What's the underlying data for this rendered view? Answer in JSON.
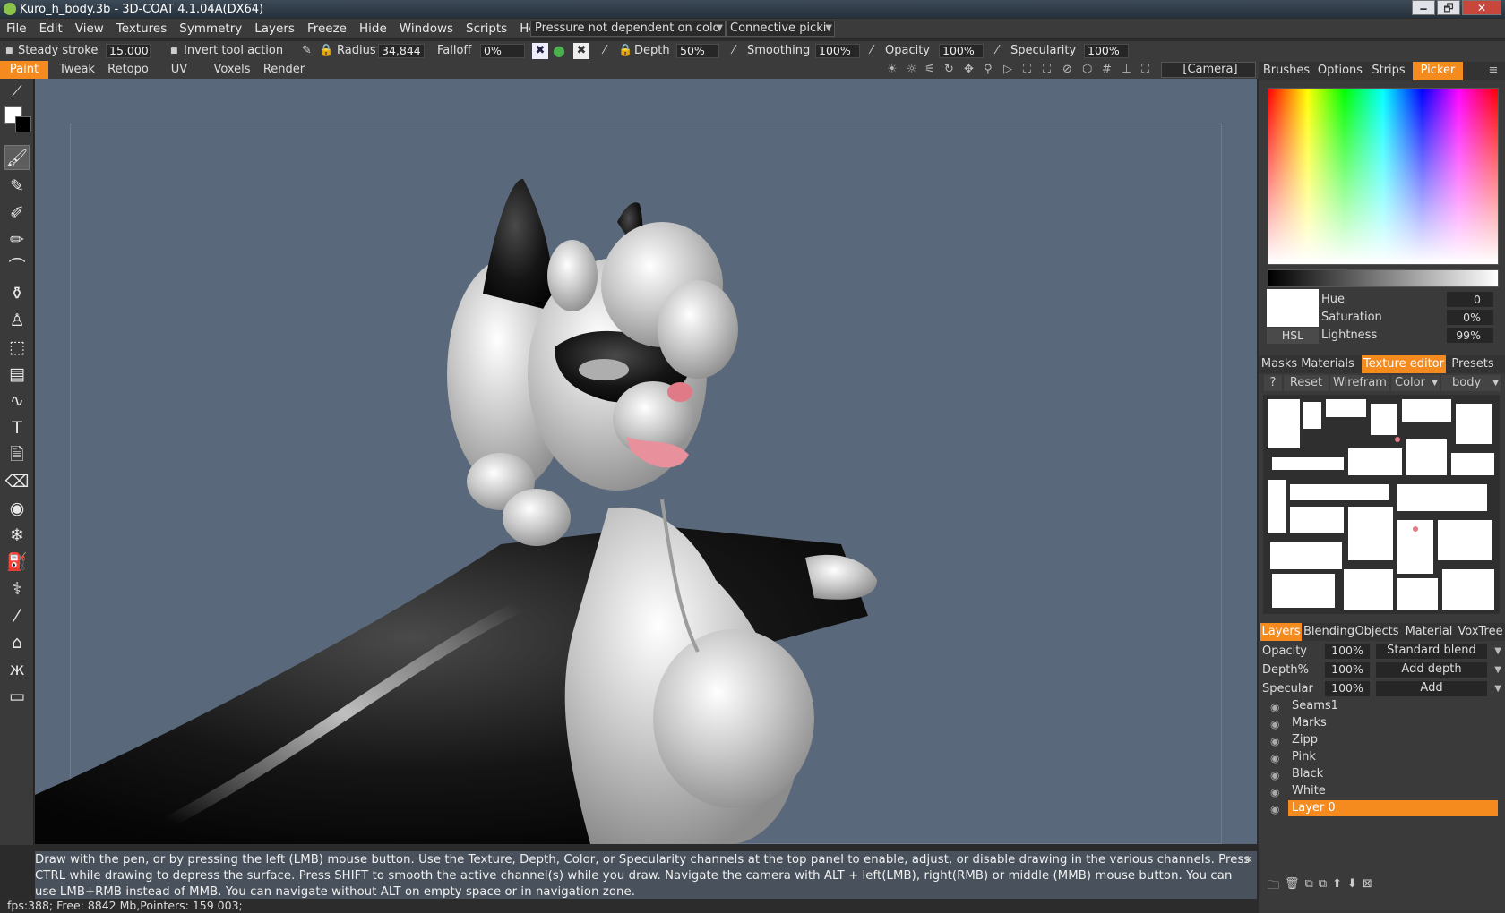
{
  "window": {
    "title": "Kuro_h_body.3b - 3D-COAT 4.1.04A(DX64)",
    "min": "🗕",
    "max": "🗗",
    "close": "✕"
  },
  "menu": [
    "File",
    "Edit",
    "View",
    "Textures",
    "Symmetry",
    "Layers",
    "Freeze",
    "Hide",
    "Windows",
    "Scripts",
    "Help"
  ],
  "menu_dropdowns": {
    "pressure": "Pressure not dependent on colo",
    "picking": "Connective picki"
  },
  "tool_options": {
    "steady_stroke_label": "Steady stroke",
    "steady_stroke_value": "15,000",
    "invert_label": "Invert tool action",
    "radius_label": "Radius",
    "radius_value": "34,844",
    "falloff_label": "Falloff",
    "falloff_value": "0%",
    "depth_label": "Depth",
    "depth_value": "50%",
    "smoothing_label": "Smoothing",
    "smoothing_value": "100%",
    "opacity_label": "Opacity",
    "opacity_value": "100%",
    "specularity_label": "Specularity",
    "specularity_value": "100%"
  },
  "rooms": [
    "Paint",
    "Tweak",
    "Retopo",
    "UV",
    "Voxels",
    "Render"
  ],
  "active_room": "Paint",
  "camera_dropdown": "[Camera]",
  "hint": {
    "line1": "Draw with the pen, or by pressing the left (LMB) mouse button. Use the Texture, Depth, Color, or Specularity channels at the top panel to enable, adjust, or disable drawing in the various channels. Press",
    "line2": "CTRL while drawing to depress the surface. Press SHIFT to smooth the active channel(s) while you draw. Navigate the camera with ALT + left(LMB), right(RMB)  or middle (MMB) mouse button. You can",
    "line3": "use LMB+RMB instead of MMB. You can navigate without ALT on empty space or in navigation zone.",
    "close": "✕"
  },
  "status": "fps:388;  Free: 8842 Mb,Pointers: 159 003;",
  "right_panel": {
    "top_tabs": [
      "Brushes",
      "Options",
      "Strips",
      "Picker"
    ],
    "picker": {
      "mode": "HSL",
      "hue_label": "Hue",
      "hue_value": "0",
      "saturation_label": "Saturation",
      "saturation_value": "0%",
      "lightness_label": "Lightness",
      "lightness_value": "99%"
    },
    "mid_tabs": [
      "Masks",
      "Materials",
      "Texture editor",
      "Presets"
    ],
    "texture_editor": {
      "help": "?",
      "reset": "Reset",
      "wireframe": "Wirefram",
      "channel": "Color",
      "object": "body"
    },
    "layer_tabs": [
      "Layers",
      "Blending",
      "Objects",
      "Material",
      "VoxTree"
    ],
    "layer_props": {
      "opacity_label": "Opacity",
      "opacity_value": "100%",
      "opacity_mode": "Standard blend",
      "depth_label": "Depth%",
      "depth_value": "100%",
      "depth_mode": "Add depth",
      "specular_label": "Specular",
      "specular_value": "100%",
      "specular_mode": "Add"
    },
    "layers": [
      "Seams1",
      "Marks",
      "Zipp",
      "Pink",
      "Black",
      "White",
      "Layer 0"
    ],
    "selected_layer": "Layer 0"
  },
  "colors": {
    "accent": "#f58a1f",
    "viewport_bg": "#59687a",
    "panel_bg": "#3a3a3a"
  },
  "icons": [
    "brush-icon",
    "pen-icon",
    "airbrush-icon",
    "smudge-icon",
    "stamp-icon",
    "text-icon",
    "eraser-icon",
    "eye-icon",
    "snowflake-icon",
    "fill-icon",
    "picker-icon",
    "butterfly-icon",
    "ruler-icon"
  ]
}
